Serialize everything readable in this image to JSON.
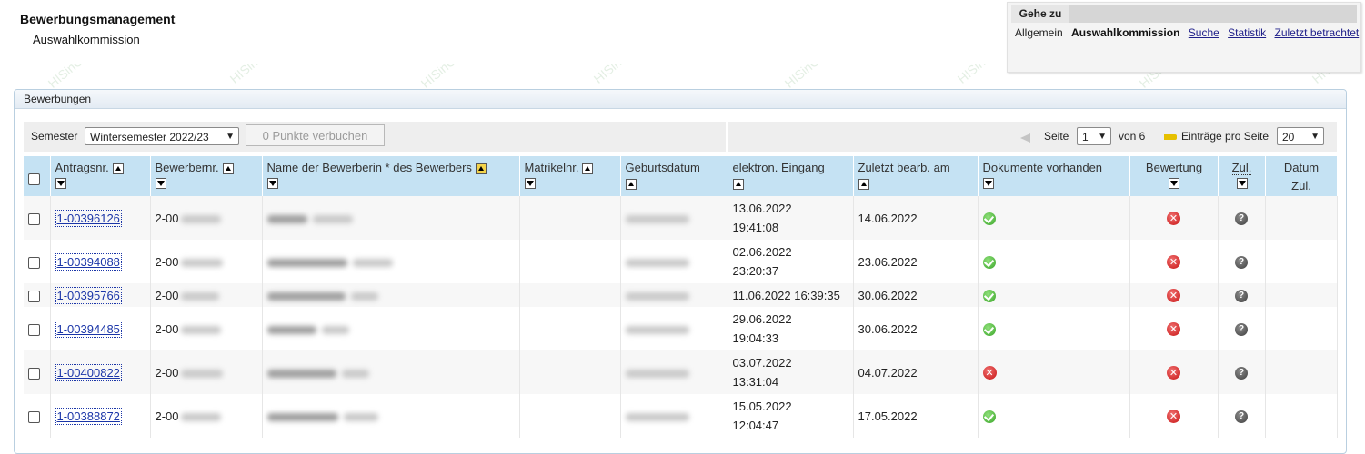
{
  "header": {
    "title": "Bewerbungsmanagement",
    "subtitle": "Auswahlkommission"
  },
  "goto": {
    "label": "Gehe zu",
    "items": [
      {
        "label": "Allgemein",
        "kind": "plain"
      },
      {
        "label": "Auswahlkommission",
        "kind": "active"
      },
      {
        "label": "Suche",
        "kind": "link"
      },
      {
        "label": "Statistik",
        "kind": "link"
      },
      {
        "label": "Zuletzt betrachtet",
        "kind": "link"
      }
    ]
  },
  "watermark": "HISinOne Q-System",
  "panel": {
    "title": "Bewerbungen"
  },
  "toolbar": {
    "semester_label": "Semester",
    "semester_value": "Wintersemester 2022/23",
    "button_label": "0 Punkte verbuchen",
    "page_label": "Seite",
    "page_value": "1",
    "page_of": "von 6",
    "per_page_label": "Einträge pro Seite",
    "per_page_value": "20"
  },
  "columns": {
    "antragsnr": "Antragsnr.",
    "bewerbernr": "Bewerbernr.",
    "name": "Name der Bewerberin * des Bewerbers",
    "matrikelnr": "Matrikelnr.",
    "geburtsdatum": "Geburtsdatum",
    "eingang": "elektron. Eingang",
    "zuletzt": "Zuletzt bearb. am",
    "dokumente": "Dokumente vorhanden",
    "bewertung": "Bewertung",
    "zul": "Zul.",
    "datum": "Datum",
    "datum2": "Zul."
  },
  "rows": [
    {
      "antrag": "1-00396126",
      "bewerber_prefix": "2-00",
      "eingang1": "13.06.2022",
      "eingang2": "19:41:08",
      "zuletzt": "14.06.2022",
      "docs": "ok",
      "bewertung": "x",
      "zul": "?"
    },
    {
      "antrag": "1-00394088",
      "bewerber_prefix": "2-00",
      "eingang1": "02.06.2022",
      "eingang2": "23:20:37",
      "zuletzt": "23.06.2022",
      "docs": "ok",
      "bewertung": "x",
      "zul": "?"
    },
    {
      "antrag": "1-00395766",
      "bewerber_prefix": "2-00",
      "eingang1": "11.06.2022 16:39:35",
      "eingang2": "",
      "zuletzt": "30.06.2022",
      "docs": "ok",
      "bewertung": "x",
      "zul": "?"
    },
    {
      "antrag": "1-00394485",
      "bewerber_prefix": "2-00",
      "eingang1": "29.06.2022",
      "eingang2": "19:04:33",
      "zuletzt": "30.06.2022",
      "docs": "ok",
      "bewertung": "x",
      "zul": "?"
    },
    {
      "antrag": "1-00400822",
      "bewerber_prefix": "2-00",
      "eingang1": "03.07.2022",
      "eingang2": "13:31:04",
      "zuletzt": "04.07.2022",
      "docs": "x",
      "bewertung": "x",
      "zul": "?"
    },
    {
      "antrag": "1-00388872",
      "bewerber_prefix": "2-00",
      "eingang1": "15.05.2022",
      "eingang2": "12:04:47",
      "zuletzt": "17.05.2022",
      "docs": "ok",
      "bewertung": "x",
      "zul": "?"
    }
  ]
}
